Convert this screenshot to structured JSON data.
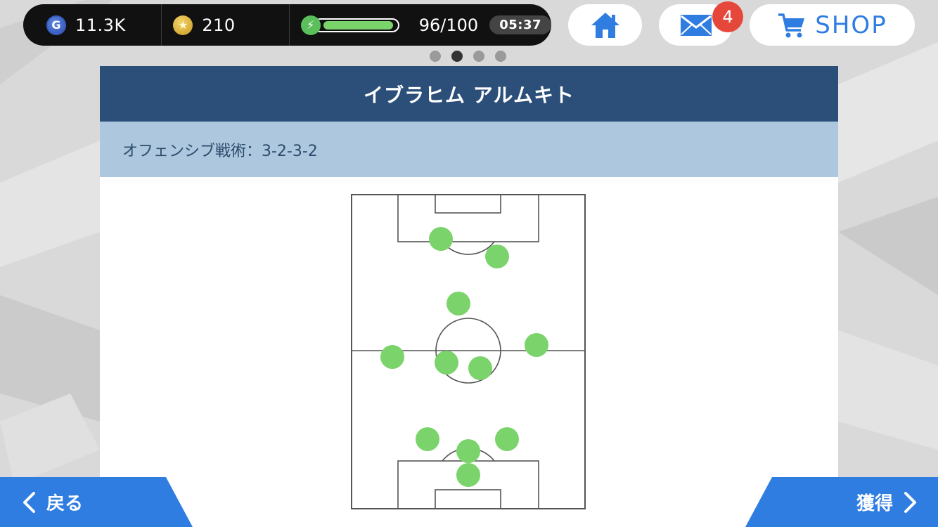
{
  "header": {
    "gold_value": "11.3K",
    "coin_value": "210",
    "energy_value": "96/100",
    "energy_fraction": 0.96,
    "timer": "05:37",
    "mail_badge": "4",
    "shop_label": "SHOP",
    "gold_icon_letter": "G"
  },
  "pagination": {
    "count": 4,
    "active_index": 1
  },
  "panel": {
    "title": "イブラヒム アルムキト",
    "tactic": "オフェンシブ戦術：3-2-3-2"
  },
  "footer": {
    "back_label": "戻る",
    "get_label": "獲得"
  },
  "colors": {
    "accent_blue": "#2f7de1",
    "panel_header": "#2c4f7a",
    "panel_sub": "#adc8de",
    "player_dot": "#7bd36b",
    "badge_red": "#e5483b"
  }
}
